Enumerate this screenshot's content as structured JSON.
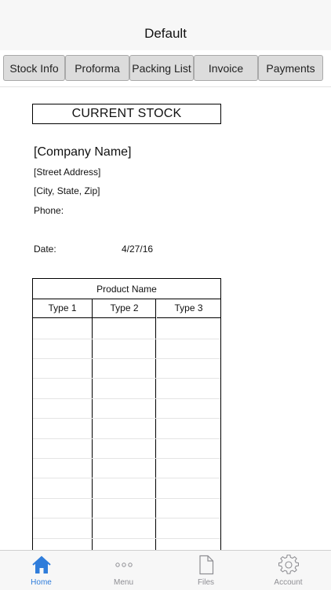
{
  "navbar": {
    "title": "Default"
  },
  "tabs": [
    {
      "label": "Stock Info"
    },
    {
      "label": "Proforma"
    },
    {
      "label": "Packing List"
    },
    {
      "label": "Invoice"
    },
    {
      "label": "Payments"
    }
  ],
  "document": {
    "title": "CURRENT STOCK",
    "company_name": "[Company Name]",
    "street": "[Street Address]",
    "city": "[City, State, Zip]",
    "phone_label": "Phone:",
    "date_label": "Date:",
    "date_value": "4/27/16",
    "table": {
      "header": "Product Name",
      "columns": [
        "Type 1",
        "Type 2",
        "Type 3"
      ]
    }
  },
  "tabbar": {
    "items": [
      {
        "label": "Home",
        "icon": "home-icon",
        "active": true
      },
      {
        "label": "Menu",
        "icon": "more-icon",
        "active": false
      },
      {
        "label": "Files",
        "icon": "file-icon",
        "active": false
      },
      {
        "label": "Account",
        "icon": "gear-icon",
        "active": false
      }
    ],
    "active_color": "#2f7ddb",
    "inactive_color": "#8e8e93"
  }
}
